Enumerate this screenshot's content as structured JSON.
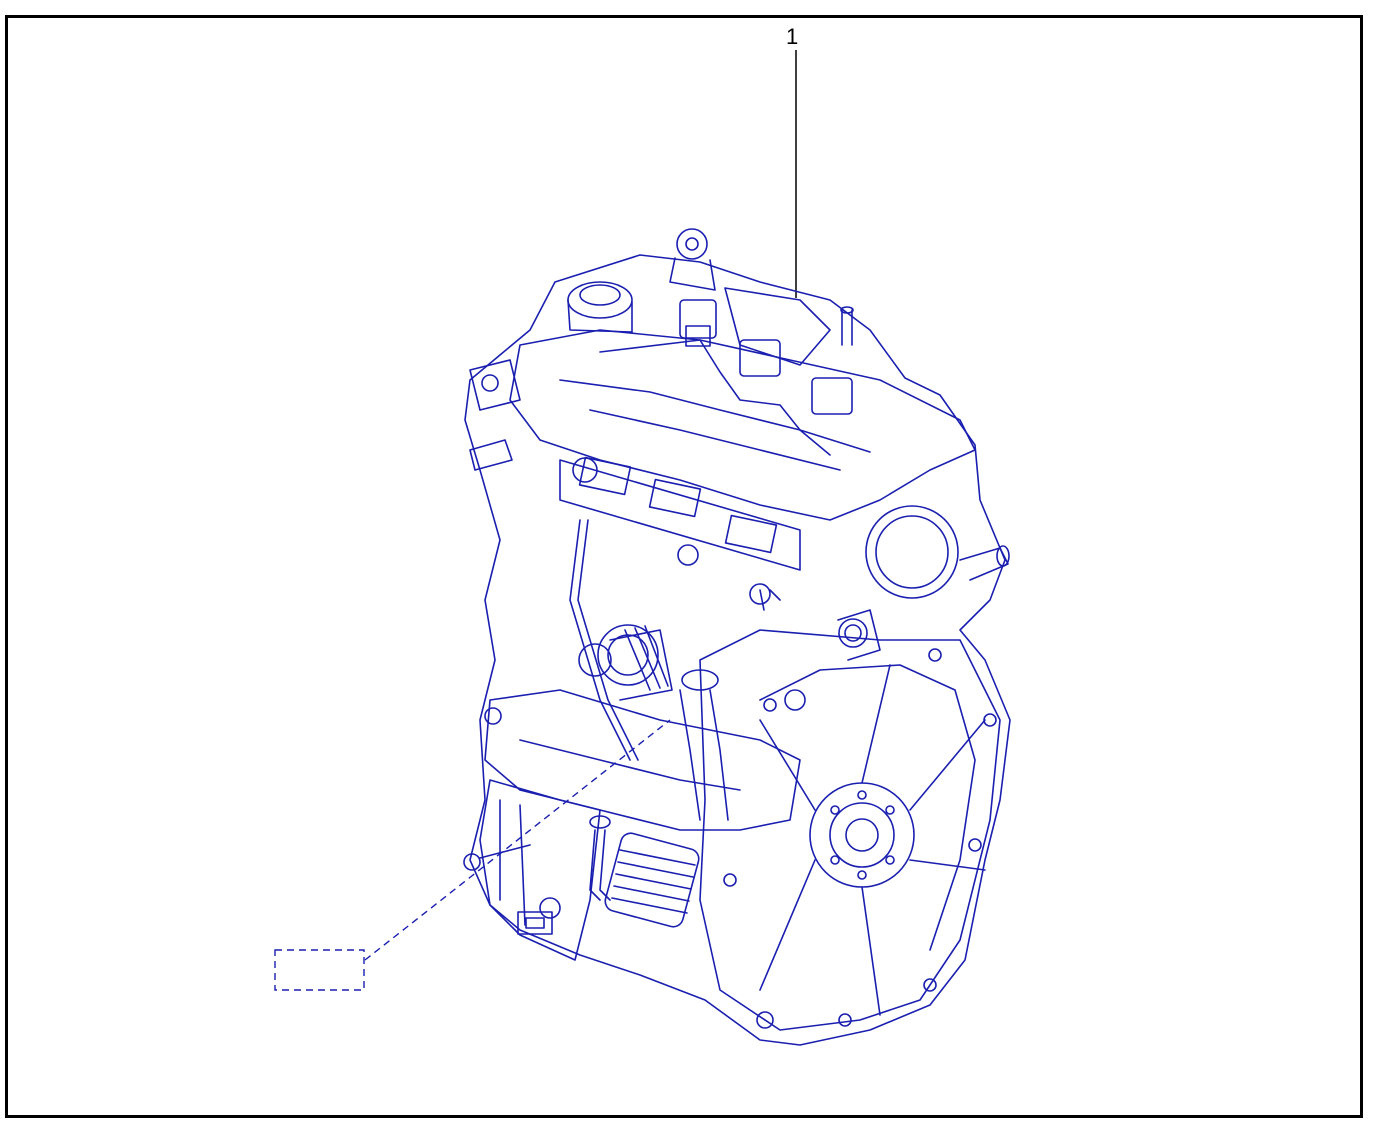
{
  "diagram": {
    "callouts": [
      {
        "number": "1",
        "target": "engine-assembly"
      }
    ],
    "colors": {
      "line_art": "#1a1fb0",
      "frame": "#000000",
      "background": "#ffffff"
    }
  }
}
